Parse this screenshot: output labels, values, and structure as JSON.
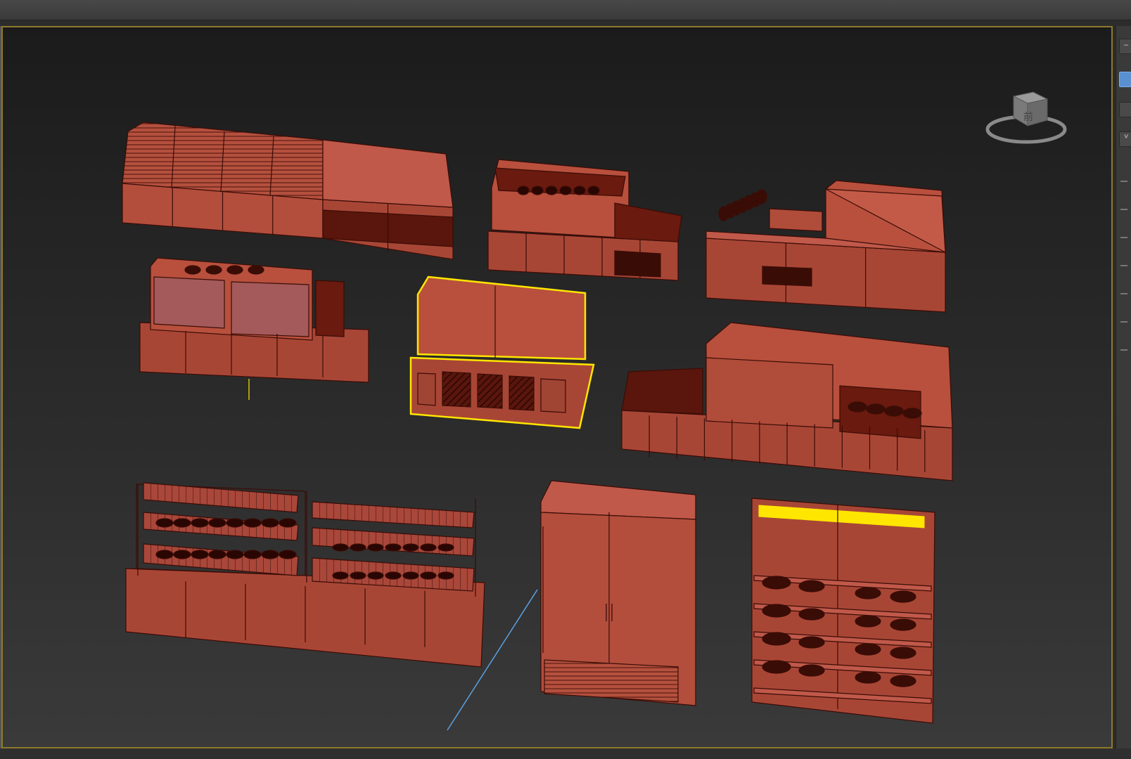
{
  "app": {
    "accent_color": "#5a8fd0",
    "viewport_border_color": "#8d7a2c",
    "selection_color": "#ffe600"
  },
  "viewport": {
    "mode": "perspective",
    "display_style": "wireframe-shaded",
    "object_color": "#b8503d",
    "edge_color": "#3a0c06"
  },
  "viewcube": {
    "icon": "viewcube-icon",
    "face_label": "前"
  },
  "side_panel": {
    "items": [
      {
        "icon": "minus-icon",
        "glyph": "–",
        "active": false
      },
      {
        "icon": "create-icon",
        "glyph": "",
        "active": true
      },
      {
        "icon": "modify-icon",
        "glyph": "",
        "active": false
      },
      {
        "icon": "rollout-collapse-icon",
        "glyph": "˅",
        "active": false
      }
    ]
  },
  "scene_objects": [
    {
      "name": "curved-glass-deli-counter"
    },
    {
      "name": "open-display-counter"
    },
    {
      "name": "service-counter-with-plants"
    },
    {
      "name": "dessert-display-counter"
    },
    {
      "name": "selected-display-cabinet",
      "selected": true
    },
    {
      "name": "coffee-bar-counter"
    },
    {
      "name": "bakery-shelf-rack"
    },
    {
      "name": "double-door-refrigerator"
    },
    {
      "name": "cake-shelf-unit"
    }
  ]
}
